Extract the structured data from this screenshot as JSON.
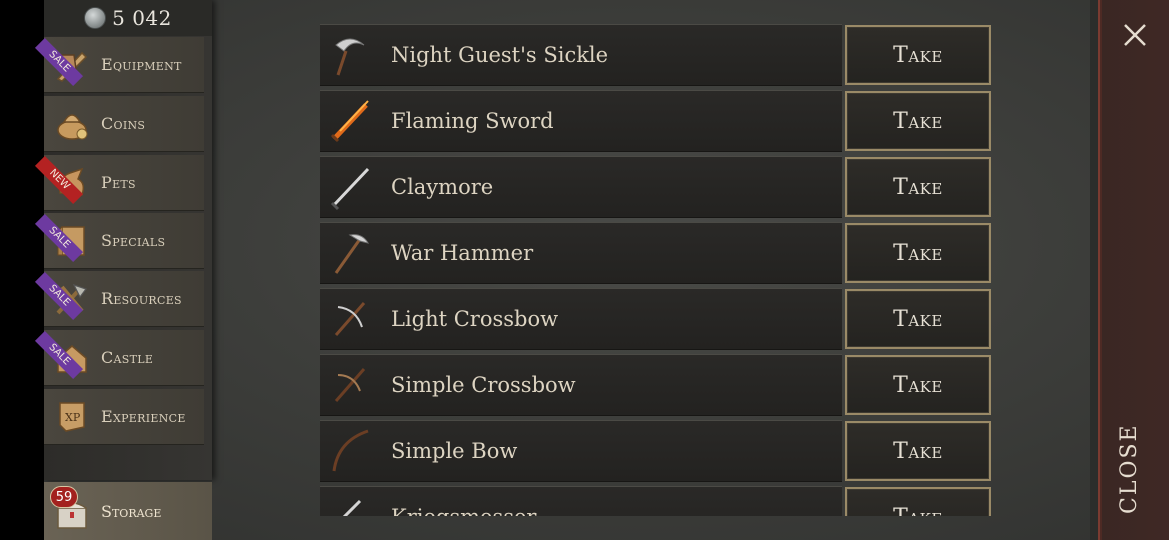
{
  "currency": {
    "value": "5 042",
    "icon": "silver-coin-icon"
  },
  "sidebar": {
    "items": [
      {
        "label": "Equipment",
        "badge": "SALE",
        "badge_type": "sale",
        "icon": "equipment-icon"
      },
      {
        "label": "Coins",
        "badge": "",
        "badge_type": "",
        "icon": "coins-icon"
      },
      {
        "label": "Pets",
        "badge": "NEW",
        "badge_type": "new",
        "icon": "pets-icon"
      },
      {
        "label": "Specials",
        "badge": "SALE",
        "badge_type": "sale",
        "icon": "specials-icon"
      },
      {
        "label": "Resources",
        "badge": "SALE",
        "badge_type": "sale",
        "icon": "resources-icon"
      },
      {
        "label": "Castle",
        "badge": "SALE",
        "badge_type": "sale",
        "icon": "castle-icon"
      },
      {
        "label": "Experience",
        "badge": "",
        "badge_type": "",
        "icon": "experience-icon"
      }
    ],
    "storage": {
      "label": "Storage",
      "count": "59",
      "icon": "storage-chest-icon"
    }
  },
  "items": [
    {
      "name": "Night Guest's Sickle",
      "action": "Take",
      "icon": "sickle-icon"
    },
    {
      "name": "Flaming Sword",
      "action": "Take",
      "icon": "flaming-sword-icon"
    },
    {
      "name": "Claymore",
      "action": "Take",
      "icon": "claymore-icon"
    },
    {
      "name": "War Hammer",
      "action": "Take",
      "icon": "war-hammer-icon"
    },
    {
      "name": "Light Crossbow",
      "action": "Take",
      "icon": "crossbow-icon"
    },
    {
      "name": "Simple Crossbow",
      "action": "Take",
      "icon": "crossbow-icon"
    },
    {
      "name": "Simple Bow",
      "action": "Take",
      "icon": "bow-icon"
    },
    {
      "name": "Kriegsmesser",
      "action": "Take",
      "icon": "sword-icon"
    }
  ],
  "close": {
    "label": "CLOSE",
    "icon": "close-icon"
  },
  "colors": {
    "sale": "#6d3aa0",
    "new": "#b42222",
    "button_border": "#9a8a67",
    "close_panel": "#3f2825"
  }
}
